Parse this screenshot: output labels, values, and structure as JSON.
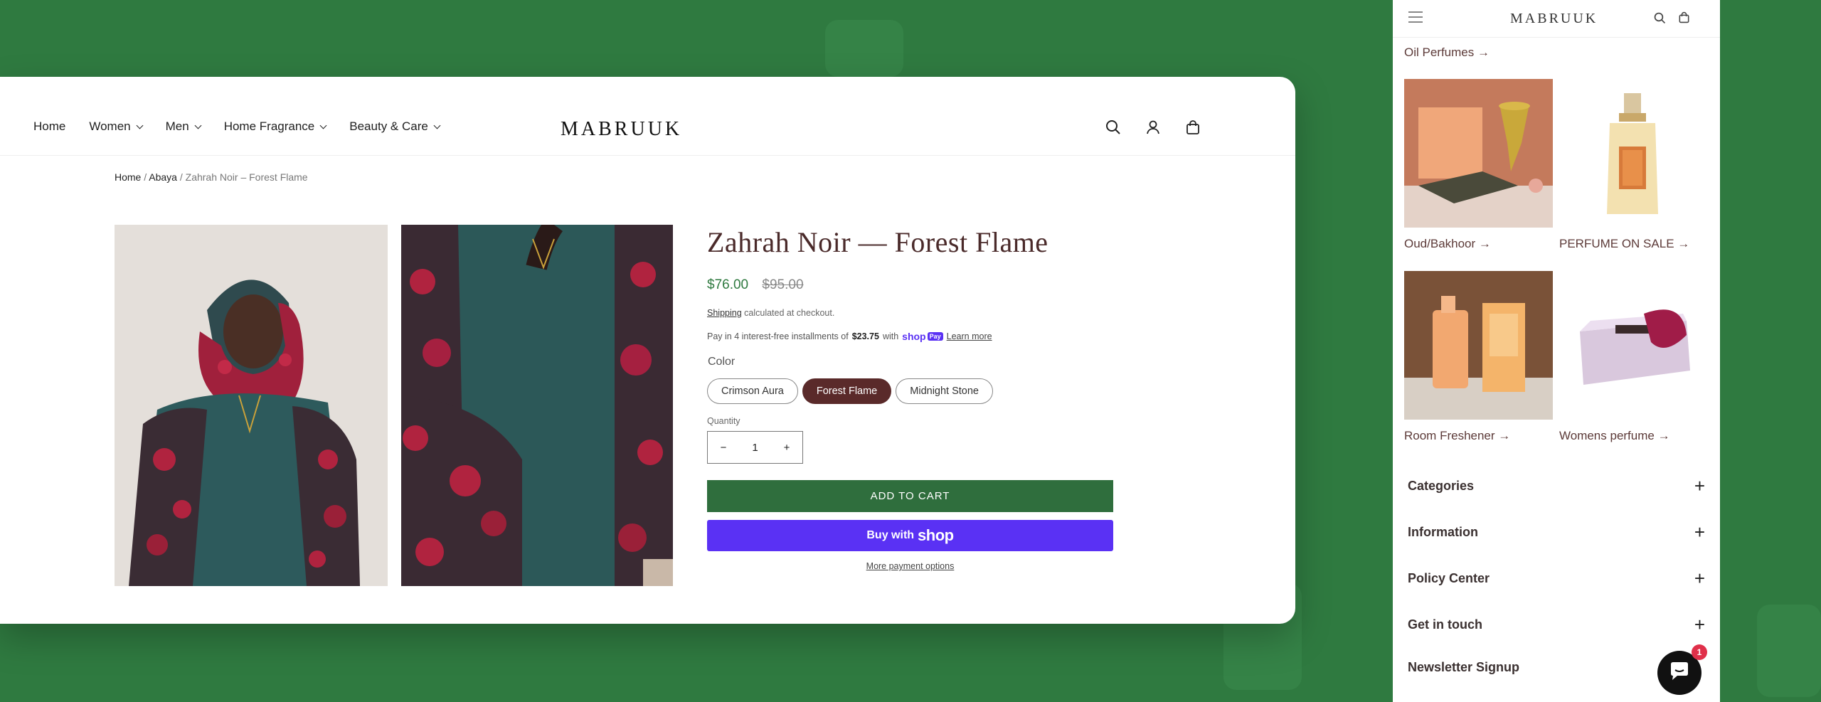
{
  "desktop": {
    "nav": {
      "links": [
        {
          "label": "Home",
          "has_dropdown": false
        },
        {
          "label": "Women",
          "has_dropdown": true
        },
        {
          "label": "Men",
          "has_dropdown": true
        },
        {
          "label": "Home Fragrance",
          "has_dropdown": true
        },
        {
          "label": "Beauty & Care",
          "has_dropdown": true
        }
      ],
      "logo": "MABRUUK",
      "icons": [
        "search-icon",
        "account-icon",
        "cart-icon"
      ]
    },
    "breadcrumb": {
      "home": "Home",
      "sep1": "/",
      "category": "Abaya",
      "sep2": "/",
      "current": "Zahrah Noir – Forest Flame"
    },
    "product": {
      "title": "Zahrah Noir — Forest Flame",
      "price": "$76.00",
      "compare_price": "$95.00",
      "shipping_link": "Shipping",
      "shipping_text": "calculated at checkout.",
      "installments_prefix": "Pay in 4 interest-free installments of",
      "installment_amount": "$23.75",
      "installments_with": "with",
      "shoppay_word": "shop",
      "shoppay_pay": "Pay",
      "learn_more": "Learn more",
      "color_label": "Color",
      "colors": [
        "Crimson Aura",
        "Forest Flame",
        "Midnight Stone"
      ],
      "selected_color": "Forest Flame",
      "quantity_label": "Quantity",
      "quantity": "1",
      "qty_minus": "−",
      "qty_plus": "+",
      "add_to_cart": "ADD TO CART",
      "buy_with": "Buy with",
      "buy_shop": "shop",
      "more_payment": "More payment options"
    }
  },
  "mobile": {
    "logo": "MABRUUK",
    "top_link": "Oil Perfumes →",
    "tiles": [
      {
        "label": "Oud/Bakhoor →"
      },
      {
        "label": "PERFUME ON SALE →"
      },
      {
        "label": "Room Freshener →"
      },
      {
        "label": "Womens perfume →"
      }
    ],
    "accordions": [
      {
        "label": "Categories",
        "icon": "+"
      },
      {
        "label": "Information",
        "icon": "+"
      },
      {
        "label": "Policy Center",
        "icon": "+"
      },
      {
        "label": "Get in touch",
        "icon": "+"
      },
      {
        "label": "Newsletter Signup",
        "icon": ""
      }
    ],
    "chat_badge": "1"
  },
  "colors": {
    "background": "#2f7a40",
    "add_to_cart": "#2f6e3d",
    "shop_pay": "#5a31f4",
    "selected_swatch": "#5a2a2a",
    "price": "#2f7a40"
  }
}
